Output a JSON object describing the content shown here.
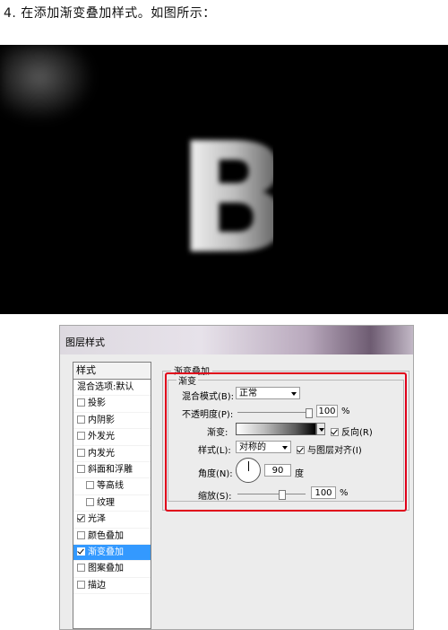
{
  "header": {
    "step_text": "4. 在添加渐变叠加样式。如图所示："
  },
  "preview": {
    "letter": "B"
  },
  "dialog": {
    "title": "图层样式",
    "left_panel": {
      "header": "样式",
      "items": [
        {
          "label": "混合选项:默认",
          "checkbox": false
        },
        {
          "label": "投影",
          "checkbox": true,
          "checked": false
        },
        {
          "label": "内阴影",
          "checkbox": true,
          "checked": false
        },
        {
          "label": "外发光",
          "checkbox": true,
          "checked": false
        },
        {
          "label": "内发光",
          "checkbox": true,
          "checked": false
        },
        {
          "label": "斜面和浮雕",
          "checkbox": true,
          "checked": false
        },
        {
          "label": "等高线",
          "checkbox": true,
          "checked": false
        },
        {
          "label": "纹理",
          "checkbox": true,
          "checked": false
        },
        {
          "label": "光泽",
          "checkbox": true,
          "checked": true
        },
        {
          "label": "颜色叠加",
          "checkbox": true,
          "checked": false
        },
        {
          "label": "渐变叠加",
          "checkbox": true,
          "checked": true,
          "selected": true
        },
        {
          "label": "图案叠加",
          "checkbox": true,
          "checked": false
        },
        {
          "label": "描边",
          "checkbox": true,
          "checked": false
        }
      ]
    },
    "section_title": "渐变叠加",
    "group_title": "渐变",
    "blend_mode": {
      "label": "混合模式(B):",
      "value": "正常"
    },
    "opacity": {
      "label": "不透明度(P):",
      "value": "100",
      "unit": "%",
      "fraction": 1.0
    },
    "gradient": {
      "label": "渐变:",
      "reverse_label": "反向(R)",
      "reverse_checked": true
    },
    "style": {
      "label": "样式(L):",
      "value": "对称的",
      "align_label": "与图层对齐(I)",
      "align_checked": true
    },
    "angle": {
      "label": "角度(N):",
      "value": "90",
      "unit": "度"
    },
    "scale": {
      "label": "缩放(S):",
      "value": "100",
      "unit": "%",
      "fraction": 0.67
    }
  },
  "colors": {
    "highlight": "#e0001a",
    "selection": "#3399ff"
  }
}
